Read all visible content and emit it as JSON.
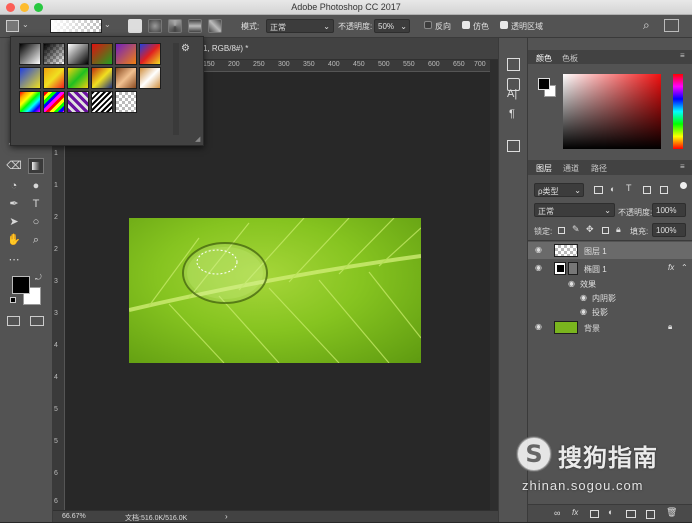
{
  "window": {
    "title": "Adobe Photoshop CC 2017"
  },
  "options_bar": {
    "mode_label": "模式:",
    "mode_value": "正常",
    "opacity_label": "不透明度:",
    "opacity_value": "50%",
    "reverse_label": "反向",
    "dither_label": "仿色",
    "transparency_label": "透明区域"
  },
  "document": {
    "tab_title": "1, RGB/8#) *",
    "ruler_top": [
      "150",
      "200",
      "250",
      "300",
      "350",
      "400",
      "450",
      "500",
      "550",
      "600",
      "650",
      "700"
    ],
    "ruler_left": [
      "1",
      "1",
      "2",
      "2",
      "3",
      "3",
      "4",
      "4",
      "5",
      "5",
      "6",
      "6"
    ],
    "zoom": "66.67%",
    "doc_info": "文档:516.0K/516.0K"
  },
  "color_panel": {
    "tabs": [
      "颜色",
      "色板"
    ]
  },
  "layers_panel": {
    "tabs": [
      "图层",
      "通道",
      "路径"
    ],
    "filter_kind": "ρ类型",
    "blend_mode": "正常",
    "opacity_label": "不透明度:",
    "opacity_value": "100%",
    "lock_label": "锁定:",
    "fill_label": "填充:",
    "fill_value": "100%",
    "layers": [
      {
        "name": "图层 1"
      },
      {
        "name": "椭圆 1",
        "fx": "fx"
      },
      {
        "name": "效果"
      },
      {
        "name": "内阴影"
      },
      {
        "name": "投影"
      },
      {
        "name": "背景"
      }
    ]
  },
  "watermark": {
    "brand": "搜狗指南",
    "url": "zhinan.sogou.com"
  }
}
